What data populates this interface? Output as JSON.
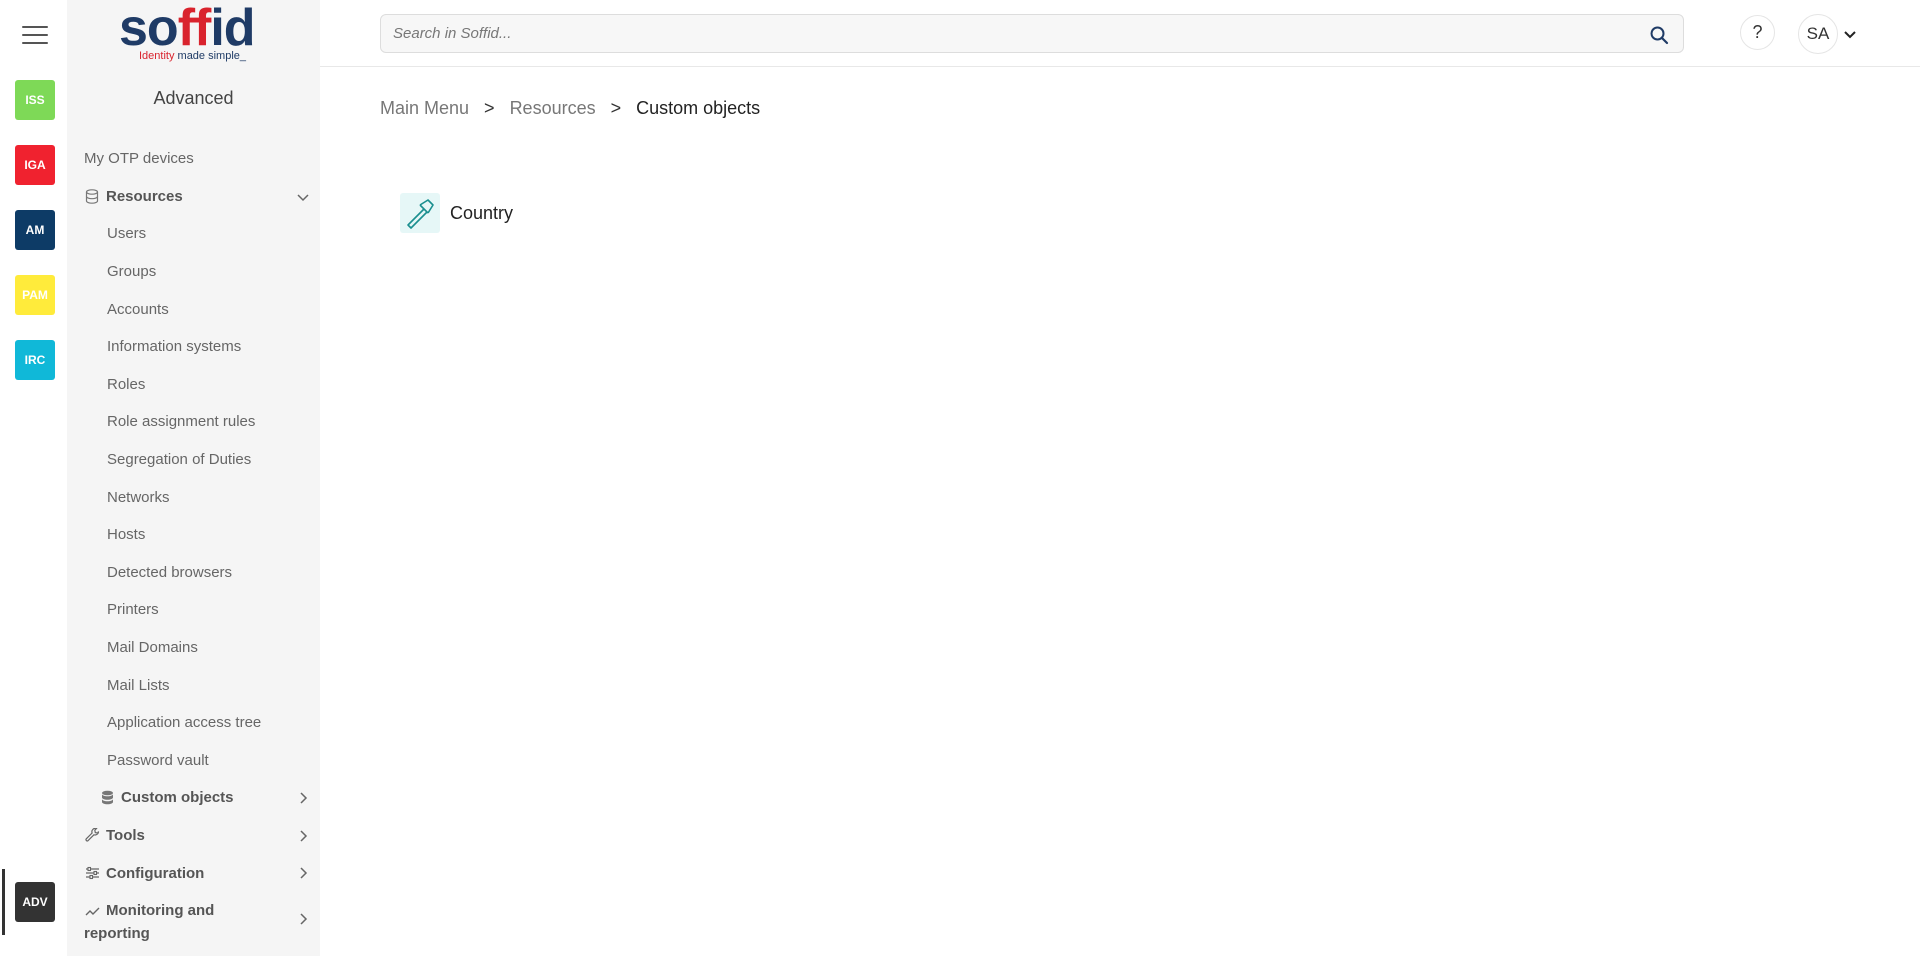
{
  "rail": {
    "apps": [
      {
        "label": "ISS",
        "color": "#7ed957"
      },
      {
        "label": "IGA",
        "color": "#f0222f"
      },
      {
        "label": "AM",
        "color": "#0d3b66"
      },
      {
        "label": "PAM",
        "color": "#ffeb3b"
      },
      {
        "label": "IRC",
        "color": "#10b8d8"
      }
    ],
    "active_app": {
      "label": "ADV",
      "color": "#333333"
    }
  },
  "sidebar": {
    "logo": {
      "word": "soffid",
      "tagline_a": "Identity",
      "tagline_b": " made simple_"
    },
    "section_title": "Advanced",
    "items": [
      {
        "label": "My OTP devices"
      },
      {
        "label": "Resources"
      },
      {
        "label": "Users"
      },
      {
        "label": "Groups"
      },
      {
        "label": "Accounts"
      },
      {
        "label": "Information systems"
      },
      {
        "label": "Roles"
      },
      {
        "label": "Role assignment rules"
      },
      {
        "label": "Segregation of Duties"
      },
      {
        "label": "Networks"
      },
      {
        "label": "Hosts"
      },
      {
        "label": "Detected browsers"
      },
      {
        "label": "Printers"
      },
      {
        "label": "Mail Domains"
      },
      {
        "label": "Mail Lists"
      },
      {
        "label": "Application access tree"
      },
      {
        "label": "Password vault"
      },
      {
        "label": "Custom objects"
      },
      {
        "label": "Tools"
      },
      {
        "label": "Configuration"
      },
      {
        "label": "Monitoring and reporting"
      }
    ]
  },
  "header": {
    "search_placeholder": "Search in Soffid...",
    "help_label": "?",
    "user_initials": "SA"
  },
  "breadcrumb": {
    "items": [
      "Main Menu",
      "Resources"
    ],
    "separator": ">",
    "current": "Custom objects"
  },
  "content": {
    "objects": [
      {
        "label": "Country",
        "icon": "hammer-icon"
      }
    ]
  }
}
